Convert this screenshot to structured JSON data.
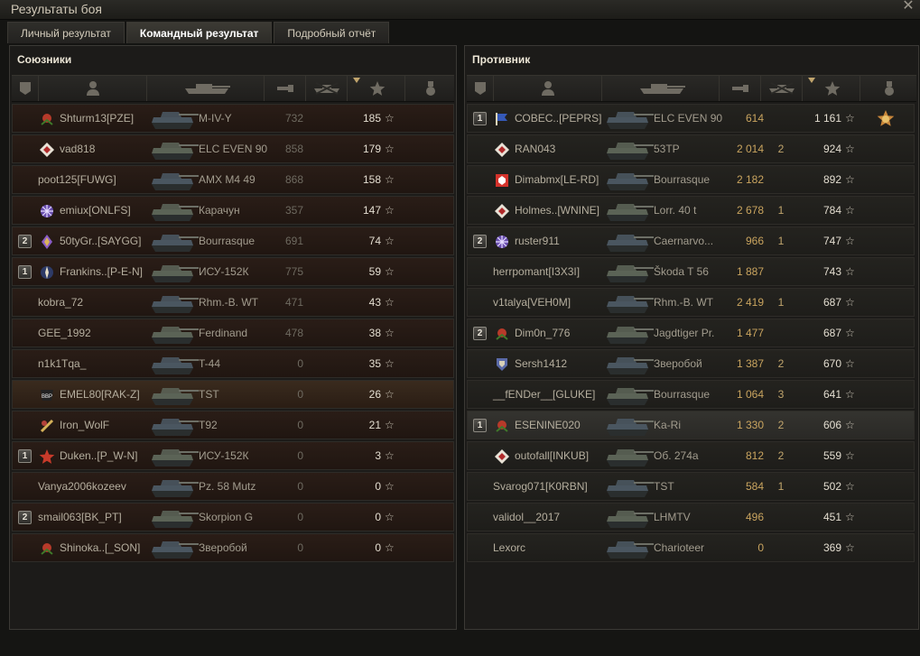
{
  "window": {
    "title": "Результаты боя",
    "close_glyph": "✕"
  },
  "tabs": [
    {
      "label": "Личный результат",
      "active": false
    },
    {
      "label": "Командный результат",
      "active": true
    },
    {
      "label": "Подробный отчёт",
      "active": false
    }
  ],
  "allies": {
    "title": "Союзники",
    "rows": [
      {
        "platoon": "",
        "clan_icon": "rose-emblem-icon",
        "name": "Shturm13[PZE]",
        "tank": "M-IV-Y",
        "damage": "732",
        "kills": "",
        "xp": "185",
        "star": "☆",
        "state": "dead"
      },
      {
        "platoon": "",
        "clan_icon": "diamond-emblem-icon",
        "name": "vad818",
        "tank": "ELC EVEN 90",
        "damage": "858",
        "kills": "",
        "xp": "179",
        "star": "☆",
        "state": "dead"
      },
      {
        "platoon": "",
        "clan_icon": "",
        "name": "poot125[FUWG]",
        "tank": "AMX M4 49",
        "damage": "868",
        "kills": "",
        "xp": "158",
        "star": "☆",
        "state": "dead"
      },
      {
        "platoon": "",
        "clan_icon": "snowflake-emblem-icon",
        "name": "emiux[ONLFS]",
        "tank": "Карачун",
        "damage": "357",
        "kills": "",
        "xp": "147",
        "star": "☆",
        "state": "dead"
      },
      {
        "platoon": "2",
        "clan_icon": "crystal-emblem-icon",
        "name": "50tyGr..[SAYGG]",
        "tank": "Bourrasque",
        "damage": "691",
        "kills": "",
        "xp": "74",
        "star": "☆",
        "state": "dead"
      },
      {
        "platoon": "1",
        "clan_icon": "compass-emblem-icon",
        "name": "Frankins..[P-E-N]",
        "tank": "ИСУ-152К",
        "damage": "775",
        "kills": "",
        "xp": "59",
        "star": "☆",
        "state": "dead"
      },
      {
        "platoon": "",
        "clan_icon": "",
        "name": "kobra_72",
        "tank": "Rhm.-B. WT",
        "damage": "471",
        "kills": "",
        "xp": "43",
        "star": "☆",
        "state": "dead"
      },
      {
        "platoon": "",
        "clan_icon": "",
        "name": "GEE_1992",
        "tank": "Ferdinand",
        "damage": "478",
        "kills": "",
        "xp": "38",
        "star": "☆",
        "state": "dead"
      },
      {
        "platoon": "",
        "clan_icon": "",
        "name": "n1k1Tqa_",
        "tank": "T-44",
        "damage": "0",
        "kills": "",
        "xp": "35",
        "star": "☆",
        "state": "dead"
      },
      {
        "platoon": "",
        "clan_icon": "bbp-badge-icon",
        "name": "EMEL80[RAK-Z]",
        "tank": "TST",
        "damage": "0",
        "kills": "",
        "xp": "26",
        "star": "☆",
        "state": "me"
      },
      {
        "platoon": "",
        "clan_icon": "gold-emblem-icon",
        "name": "Iron_WolF",
        "tank": "T92",
        "damage": "0",
        "kills": "",
        "xp": "21",
        "star": "☆",
        "state": "dead"
      },
      {
        "platoon": "1",
        "clan_icon": "star-emblem-icon",
        "name": "Duken..[P_W-N]",
        "tank": "ИСУ-152К",
        "damage": "0",
        "kills": "",
        "xp": "3",
        "star": "☆",
        "state": "dead"
      },
      {
        "platoon": "",
        "clan_icon": "",
        "name": "Vanya2006kozeev",
        "tank": "Pz. 58 Mutz",
        "damage": "0",
        "kills": "",
        "xp": "0",
        "star": "☆",
        "state": "dead"
      },
      {
        "platoon": "2",
        "clan_icon": "",
        "name": "smail063[BK_PT]",
        "tank": "Skorpion G",
        "damage": "0",
        "kills": "",
        "xp": "0",
        "star": "☆",
        "state": "dead"
      },
      {
        "platoon": "",
        "clan_icon": "rose-emblem-icon",
        "name": "Shinoka..[_SON]",
        "tank": "Зверобой",
        "damage": "0",
        "kills": "",
        "xp": "0",
        "star": "☆",
        "state": "dead"
      }
    ]
  },
  "enemies": {
    "title": "Противник",
    "rows": [
      {
        "platoon": "1",
        "clan_icon": "flag-emblem-icon",
        "name": "СОВЕС..[PEPRS]",
        "tank": "ELC EVEN 90",
        "damage": "614",
        "kills": "",
        "xp": "1 161",
        "star": "☆",
        "medal": true,
        "state": "alive"
      },
      {
        "platoon": "",
        "clan_icon": "diamond-emblem-icon",
        "name": "RAN043",
        "tank": "53TP",
        "damage": "2 014",
        "kills": "2",
        "xp": "924",
        "star": "☆",
        "state": "alive"
      },
      {
        "platoon": "",
        "clan_icon": "shield-emblem-icon",
        "name": "Dimabmx[LE-RD]",
        "tank": "Bourrasque",
        "damage": "2 182",
        "kills": "",
        "xp": "892",
        "star": "☆",
        "state": "alive"
      },
      {
        "platoon": "",
        "clan_icon": "diamond-emblem-icon",
        "name": "Holmes..[WNINE]",
        "tank": "Lorr. 40 t",
        "damage": "2 678",
        "kills": "1",
        "xp": "784",
        "star": "☆",
        "state": "alive"
      },
      {
        "platoon": "2",
        "clan_icon": "snowflake-emblem-icon",
        "name": "ruster911",
        "tank": "Caernarvo...",
        "damage": "966",
        "kills": "1",
        "xp": "747",
        "star": "☆",
        "state": "alive"
      },
      {
        "platoon": "",
        "clan_icon": "",
        "name": "herrpomant[I3X3I]",
        "tank": "Škoda T 56",
        "damage": "1 887",
        "kills": "",
        "xp": "743",
        "star": "☆",
        "state": "alive"
      },
      {
        "platoon": "",
        "clan_icon": "",
        "name": "v1talya[VEH0M]",
        "tank": "Rhm.-B. WT",
        "damage": "2 419",
        "kills": "1",
        "xp": "687",
        "star": "☆",
        "state": "alive"
      },
      {
        "platoon": "2",
        "clan_icon": "rose-emblem-icon",
        "name": "Dim0n_776",
        "tank": "Jagdtiger Pr.",
        "damage": "1 477",
        "kills": "",
        "xp": "687",
        "star": "☆",
        "state": "alive"
      },
      {
        "platoon": "",
        "clan_icon": "crest-emblem-icon",
        "name": "Sersh1412",
        "tank": "Зверобой",
        "damage": "1 387",
        "kills": "2",
        "xp": "670",
        "star": "☆",
        "state": "alive"
      },
      {
        "platoon": "",
        "clan_icon": "",
        "name": "__fENDer__[GLUKE]",
        "tank": "Bourrasque",
        "damage": "1 064",
        "kills": "3",
        "xp": "641",
        "star": "☆",
        "state": "alive"
      },
      {
        "platoon": "1",
        "clan_icon": "rose-emblem-icon",
        "name": "ESENINE020",
        "tank": "Ka-Ri",
        "damage": "1 330",
        "kills": "2",
        "xp": "606",
        "star": "☆",
        "state": "hl"
      },
      {
        "platoon": "",
        "clan_icon": "diamond-emblem-icon",
        "name": "outofall[INKUB]",
        "tank": "Об. 274а",
        "damage": "812",
        "kills": "2",
        "xp": "559",
        "star": "☆",
        "state": "alive"
      },
      {
        "platoon": "",
        "clan_icon": "",
        "name": "Svarog071[K0RBN]",
        "tank": "TST",
        "damage": "584",
        "kills": "1",
        "xp": "502",
        "star": "☆",
        "state": "alive"
      },
      {
        "platoon": "",
        "clan_icon": "",
        "name": "validol__2017",
        "tank": "LHMTV",
        "damage": "496",
        "kills": "",
        "xp": "451",
        "star": "☆",
        "state": "alive"
      },
      {
        "platoon": "",
        "clan_icon": "",
        "name": "Lexorc",
        "tank": "Charioteer",
        "damage": "0",
        "kills": "",
        "xp": "369",
        "star": "☆",
        "state": "alive"
      }
    ]
  },
  "header_icons": [
    "platoon-column-icon",
    "player-column-icon",
    "tank-column-icon",
    "damage-column-icon",
    "kills-column-icon",
    "xp-column-icon",
    "medal-column-icon"
  ],
  "colors": {
    "accent": "#c1a56d",
    "damage_dead": "#6e6a60",
    "damage_alive": "#c9a45f",
    "dead_row": "#2a1d17"
  }
}
